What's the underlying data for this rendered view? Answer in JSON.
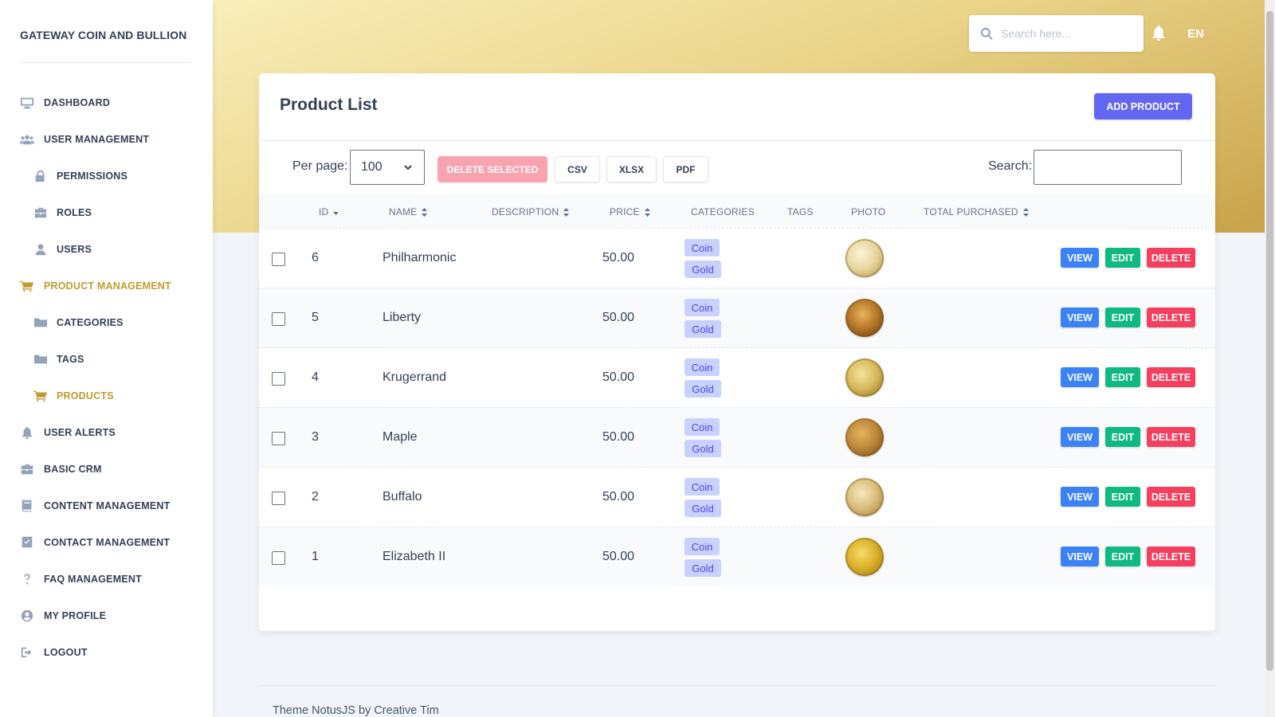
{
  "sidebar": {
    "brand": "GATEWAY COIN AND BULLION",
    "items": [
      {
        "label": "DASHBOARD",
        "icon": "monitor-icon"
      },
      {
        "label": "USER MANAGEMENT",
        "icon": "users-icon"
      },
      {
        "label": "PERMISSIONS",
        "icon": "lock-icon"
      },
      {
        "label": "ROLES",
        "icon": "briefcase-icon"
      },
      {
        "label": "USERS",
        "icon": "user-icon"
      },
      {
        "label": "PRODUCT MANAGEMENT",
        "icon": "cart-icon"
      },
      {
        "label": "CATEGORIES",
        "icon": "folder-icon"
      },
      {
        "label": "TAGS",
        "icon": "folder-icon"
      },
      {
        "label": "PRODUCTS",
        "icon": "cart-icon"
      },
      {
        "label": "USER ALERTS",
        "icon": "bell-icon"
      },
      {
        "label": "BASIC CRM",
        "icon": "briefcase-icon"
      },
      {
        "label": "CONTENT MANAGEMENT",
        "icon": "book-icon"
      },
      {
        "label": "CONTACT MANAGEMENT",
        "icon": "check-square-icon"
      },
      {
        "label": "FAQ MANAGEMENT",
        "icon": "question-icon"
      },
      {
        "label": "MY PROFILE",
        "icon": "user-circle-icon"
      },
      {
        "label": "LOGOUT",
        "icon": "logout-icon"
      }
    ]
  },
  "topbar": {
    "search_placeholder": "Search here...",
    "language": "EN"
  },
  "card": {
    "title": "Product List",
    "add_label": "ADD PRODUCT",
    "per_page_label": "Per page:",
    "per_page_value": "100",
    "delete_selected_label": "DELETE SELECTED",
    "csv_label": "CSV",
    "xlsx_label": "XLSX",
    "pdf_label": "PDF",
    "search_label": "Search:"
  },
  "table": {
    "columns": [
      "ID",
      "NAME",
      "DESCRIPTION",
      "PRICE",
      "CATEGORIES",
      "TAGS",
      "PHOTO",
      "TOTAL PURCHASED"
    ],
    "rows": [
      {
        "id": "6",
        "name": "Philharmonic",
        "price": "50.00",
        "cat1": "Coin",
        "cat2": "Gold"
      },
      {
        "id": "5",
        "name": "Liberty",
        "price": "50.00",
        "cat1": "Coin",
        "cat2": "Gold"
      },
      {
        "id": "4",
        "name": "Krugerrand",
        "price": "50.00",
        "cat1": "Coin",
        "cat2": "Gold"
      },
      {
        "id": "3",
        "name": "Maple",
        "price": "50.00",
        "cat1": "Coin",
        "cat2": "Gold"
      },
      {
        "id": "2",
        "name": "Buffalo",
        "price": "50.00",
        "cat1": "Coin",
        "cat2": "Gold"
      },
      {
        "id": "1",
        "name": "Elizabeth II",
        "price": "50.00",
        "cat1": "Coin",
        "cat2": "Gold"
      }
    ],
    "actions": {
      "view": "VIEW",
      "edit": "EDIT",
      "delete": "DELETE"
    }
  },
  "footer": {
    "text": "Theme NotusJS by Creative Tim"
  },
  "colors": {
    "accent": "#bf9b30",
    "primary": "#6366f1",
    "view": "#3b82f6",
    "edit": "#10b981",
    "delete": "#f43f5e"
  }
}
